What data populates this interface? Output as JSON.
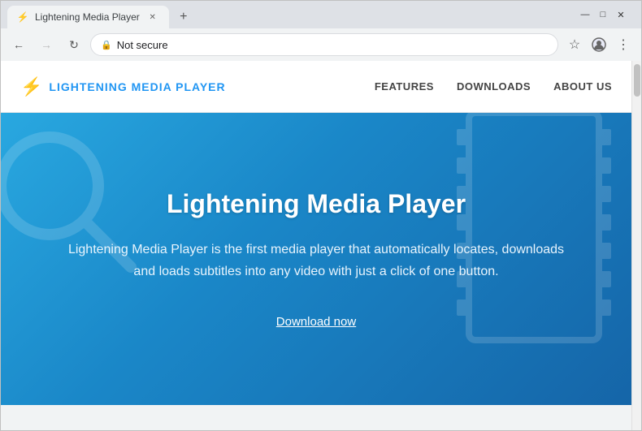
{
  "browser": {
    "tab": {
      "title": "Lightening Media Player",
      "favicon": "⚡"
    },
    "new_tab_icon": "+",
    "window_controls": {
      "minimize": "—",
      "maximize": "□",
      "close": "✕"
    },
    "nav": {
      "back_disabled": false,
      "forward_disabled": true
    },
    "address": {
      "security": "Not secure",
      "url": ""
    }
  },
  "site": {
    "nav": {
      "logo_icon": "⚡",
      "logo_text": "LIGHTENING MEDIA PLAYER",
      "links": [
        {
          "label": "FEATURES",
          "id": "features"
        },
        {
          "label": "DOWNLOADS",
          "id": "downloads"
        },
        {
          "label": "ABOUT US",
          "id": "about"
        }
      ]
    },
    "hero": {
      "title": "Lightening Media Player",
      "description": "Lightening Media Player is the first media player that automatically locates, downloads and loads subtitles into any video with just a click of one button.",
      "cta": "Download now"
    }
  }
}
